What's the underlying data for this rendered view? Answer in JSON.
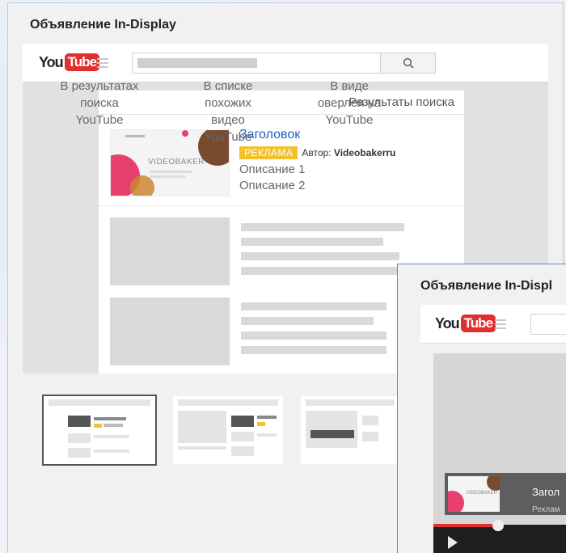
{
  "panel": {
    "title": "Объявление In-Display"
  },
  "youtube": {
    "logo_you": "You",
    "logo_tube": "Tube"
  },
  "results": {
    "header": "Результаты поиска",
    "ad": {
      "title": "Заголовок",
      "badge": "РЕКЛАМА",
      "author_prefix": "Автор:",
      "author": "Videobakerru",
      "desc1": "Описание 1",
      "desc2": "Описание 2",
      "thumb_brand": "VIDEOBAKER"
    }
  },
  "options": [
    {
      "label_lines": [
        "В результатах",
        "поиска",
        "YouTube"
      ],
      "selected": true
    },
    {
      "label_lines": [
        "В списке",
        "похожих",
        "видео",
        "YouTube"
      ],
      "selected": false
    },
    {
      "label_lines": [
        "В виде",
        "оверлея на",
        "YouTube"
      ],
      "selected": false
    }
  ],
  "overlay": {
    "title": "Объявление In-Displ",
    "logo_you": "You",
    "logo_tube": "Tube",
    "card_title": "Загол",
    "card_sub": "Реклам",
    "thumb_brand": "VIDEOBAKER"
  },
  "colors": {
    "accent_blue": "#1b62c2",
    "badge_yellow": "#f2c12e",
    "youtube_red": "#e02f2f"
  }
}
